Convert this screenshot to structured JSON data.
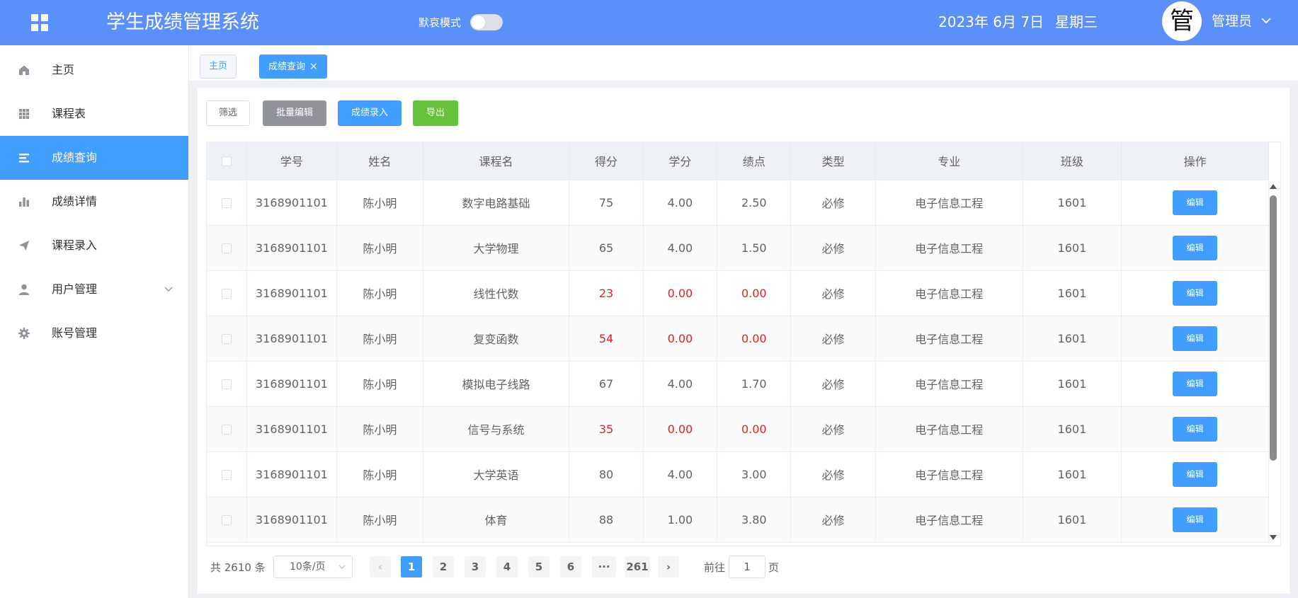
{
  "header": {
    "title": "学生成绩管理系统",
    "mode_label": "默哀模式",
    "mode_on": false,
    "date": "2023年 6月 7日",
    "weekday": "星期三",
    "avatar_char": "管",
    "user_name": "管理员"
  },
  "sidebar": {
    "items": [
      {
        "label": "主页",
        "icon": "home-icon",
        "active": false
      },
      {
        "label": "课程表",
        "icon": "grid-icon",
        "active": false
      },
      {
        "label": "成绩查询",
        "icon": "list-icon",
        "active": true
      },
      {
        "label": "成绩详情",
        "icon": "bar-chart-icon",
        "active": false
      },
      {
        "label": "课程录入",
        "icon": "send-icon",
        "active": false
      },
      {
        "label": "用户管理",
        "icon": "user-icon",
        "active": false,
        "has_submenu": true
      },
      {
        "label": "账号管理",
        "icon": "gear-icon",
        "active": false
      }
    ]
  },
  "tabs": [
    {
      "label": "主页",
      "active": false
    },
    {
      "label": "成绩查询",
      "active": true,
      "closable": true,
      "close_glyph": "×"
    }
  ],
  "toolbar": {
    "filter_label": "筛选",
    "batch_edit_label": "批量编辑",
    "grade_entry_label": "成绩录入",
    "export_label": "导出"
  },
  "table": {
    "columns": [
      "学号",
      "姓名",
      "课程名",
      "得分",
      "学分",
      "绩点",
      "类型",
      "专业",
      "班级",
      "操作"
    ],
    "edit_label": "编辑",
    "rows": [
      {
        "id": "3168901101",
        "name": "陈小明",
        "course": "数字电路基础",
        "score": "75",
        "credit": "4.00",
        "gpa": "2.50",
        "type": "必修",
        "major": "电子信息工程",
        "class": "1601",
        "failed": false
      },
      {
        "id": "3168901101",
        "name": "陈小明",
        "course": "大学物理",
        "score": "65",
        "credit": "4.00",
        "gpa": "1.50",
        "type": "必修",
        "major": "电子信息工程",
        "class": "1601",
        "failed": false
      },
      {
        "id": "3168901101",
        "name": "陈小明",
        "course": "线性代数",
        "score": "23",
        "credit": "0.00",
        "gpa": "0.00",
        "type": "必修",
        "major": "电子信息工程",
        "class": "1601",
        "failed": true
      },
      {
        "id": "3168901101",
        "name": "陈小明",
        "course": "复变函数",
        "score": "54",
        "credit": "0.00",
        "gpa": "0.00",
        "type": "必修",
        "major": "电子信息工程",
        "class": "1601",
        "failed": true
      },
      {
        "id": "3168901101",
        "name": "陈小明",
        "course": "模拟电子线路",
        "score": "67",
        "credit": "4.00",
        "gpa": "1.70",
        "type": "必修",
        "major": "电子信息工程",
        "class": "1601",
        "failed": false
      },
      {
        "id": "3168901101",
        "name": "陈小明",
        "course": "信号与系统",
        "score": "35",
        "credit": "0.00",
        "gpa": "0.00",
        "type": "必修",
        "major": "电子信息工程",
        "class": "1601",
        "failed": true
      },
      {
        "id": "3168901101",
        "name": "陈小明",
        "course": "大学英语",
        "score": "80",
        "credit": "4.00",
        "gpa": "3.00",
        "type": "必修",
        "major": "电子信息工程",
        "class": "1601",
        "failed": false
      },
      {
        "id": "3168901101",
        "name": "陈小明",
        "course": "体育",
        "score": "88",
        "credit": "1.00",
        "gpa": "3.80",
        "type": "必修",
        "major": "电子信息工程",
        "class": "1601",
        "failed": false
      }
    ]
  },
  "pagination": {
    "total": "共 2610 条",
    "page_size": "10条/页",
    "prev_glyph": "‹",
    "next_glyph": "›",
    "pages": [
      "1",
      "2",
      "3",
      "4",
      "5",
      "6",
      "···",
      "261"
    ],
    "current": "1",
    "goto_label": "前往",
    "goto_value": "1",
    "goto_unit": "页"
  },
  "colors": {
    "header": "#5b8ff9",
    "primary": "#409eff",
    "success": "#67c23a",
    "info": "#909399",
    "danger": "#e6202a"
  }
}
